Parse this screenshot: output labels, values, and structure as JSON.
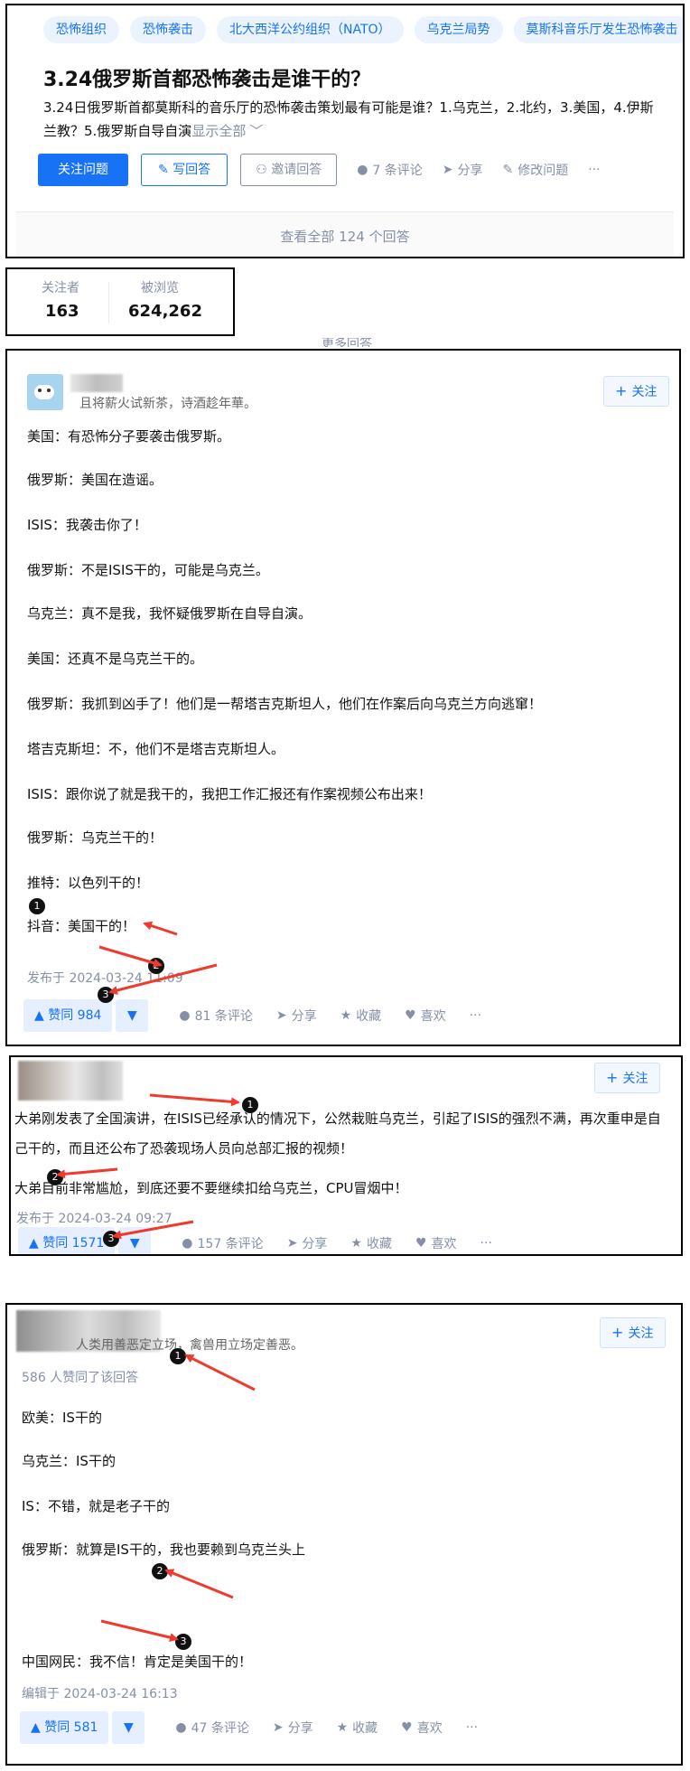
{
  "tags": [
    "恐怖组织",
    "恐怖袭击",
    "北大西洋公约组织（NATO）",
    "乌克兰局势",
    "莫斯科音乐厅发生恐怖袭击"
  ],
  "question": {
    "title": "3.24俄罗斯首都恐怖袭击是谁干的？",
    "detail_line1": "3.24日俄罗斯首都莫斯科的音乐厅的恐怖袭击策划最有可能是谁？1.乌克兰，2.北约，3.美国，4.伊斯",
    "detail_line2": "兰教？5.俄罗斯自导自演",
    "show_all": "显示全部",
    "follow_label": "关注问题",
    "write_label": "写回答",
    "invite_label": "邀请回答",
    "comments_label": "7 条评论",
    "share_label": "分享",
    "edit_label": "修改问题",
    "view_all_label": "查看全部 124 个回答"
  },
  "stats": {
    "followers_label": "关注者",
    "followers_value": "163",
    "views_label": "被浏览",
    "views_value": "624,262",
    "more_label": "更多回答"
  },
  "answers": [
    {
      "bio": "且将薪火试新茶，诗酒趁年華。",
      "follow_label": "关注",
      "lines": [
        "美国：有恐怖分子要袭击俄罗斯。",
        "俄罗斯：美国在造谣。",
        "ISIS：我袭击你了！",
        "俄罗斯：不是ISIS干的，可能是乌克兰。",
        "乌克兰：真不是我，我怀疑俄罗斯在自导自演。",
        "美国：还真不是乌克兰干的。",
        "俄罗斯：我抓到凶手了！他们是一帮塔吉克斯坦人，他们在作案后向乌克兰方向逃窜！",
        "塔吉克斯坦：不，他们不是塔吉克斯坦人。",
        "ISIS：跟你说了就是我干的，我把工作汇报还有作案视频公布出来！",
        "俄罗斯：乌克兰干的！",
        "推特：以色列干的！",
        "抖音：美国干的！"
      ],
      "date": "发布于 2024-03-24 11:09",
      "vote_label": "▲ 赞同 984",
      "comments_label": "81 条评论",
      "share_label": "分享",
      "collect_label": "收藏",
      "like_label": "喜欢"
    },
    {
      "follow_label": "关注",
      "para1": "大弟刚发表了全国演讲，在ISIS已经承认的情况下，公然栽赃乌克兰，引起了ISIS的强烈不满，再次重申是自己干的，而且还公布了恐袭现场人员向总部汇报的视频！",
      "para2": "大弟目前非常尴尬，到底还要不要继续扣给乌克兰，CPU冒烟中！",
      "date": "发布于 2024-03-24 09:27",
      "vote_label": "▲ 赞同 1571",
      "comments_label": "157 条评论",
      "share_label": "分享",
      "collect_label": "收藏",
      "like_label": "喜欢"
    },
    {
      "bio": "人类用善恶定立场，禽兽用立场定善恶。",
      "follow_label": "关注",
      "upvoted": "586 人赞同了该回答",
      "lines": [
        "欧美：IS干的",
        "乌克兰：IS干的",
        "IS：不错，就是老子干的",
        "俄罗斯：就算是IS干的，我也要赖到乌克兰头上",
        "中国网民：我不信！肯定是美国干的！"
      ],
      "date": "编辑于 2024-03-24 16:13",
      "vote_label": "▲ 赞同 581",
      "comments_label": "47 条评论",
      "share_label": "分享",
      "collect_label": "收藏",
      "like_label": "喜欢"
    }
  ],
  "markers": [
    "1",
    "2",
    "3",
    "1",
    "2",
    "3",
    "1",
    "2",
    "3"
  ],
  "icons": {
    "vote_down": "▼",
    "more": "···",
    "plus": "+",
    "chevron": "﹀"
  },
  "colors": {
    "brand": "#1772f6",
    "muted": "#8590a6",
    "arrow": "#ef3a2e"
  }
}
